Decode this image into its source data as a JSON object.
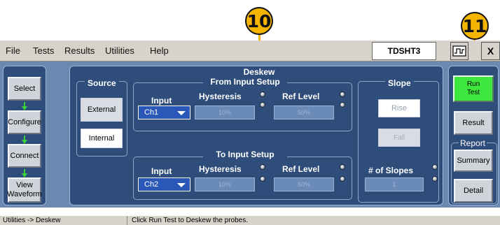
{
  "callouts": {
    "c10": "10",
    "c11": "11"
  },
  "menubar": {
    "items": [
      "File",
      "Tests",
      "Results",
      "Utilities",
      "Help"
    ],
    "app_name": "TDSHT3",
    "close_glyph": "X"
  },
  "nav": {
    "buttons": [
      {
        "label": "Select"
      },
      {
        "label": "Configure"
      },
      {
        "label": "Connect"
      },
      {
        "label": "View Waveform"
      }
    ]
  },
  "source": {
    "title": "Source",
    "external": "External",
    "internal": "Internal"
  },
  "deskew": {
    "title": "Deskew",
    "from": {
      "title": "From Input Setup",
      "input_label": "Input",
      "input_value": "Ch1",
      "hysteresis_label": "Hysteresis",
      "hysteresis_value": "10%",
      "ref_level_label": "Ref Level",
      "ref_level_value": "50%"
    },
    "to": {
      "title": "To Input Setup",
      "input_label": "Input",
      "input_value": "Ch2",
      "hysteresis_label": "Hysteresis",
      "hysteresis_value": "10%",
      "ref_level_label": "Ref Level",
      "ref_level_value": "50%"
    },
    "slope": {
      "title": "Slope",
      "rise": "Rise",
      "fall": "Fall",
      "num_label": "# of Slopes",
      "num_value": "1"
    }
  },
  "right": {
    "run_test": "Run Test",
    "result": "Result",
    "report_title": "Report",
    "summary": "Summary",
    "detail": "Detail"
  },
  "statusbar": {
    "path": "Utilities -> Deskew",
    "message": "Click Run Test to Deskew the probes."
  },
  "colors": {
    "run_test_bg": "#3ee63e",
    "callout_bg": "#f4b400",
    "panel_bg": "#2e4d7a"
  }
}
